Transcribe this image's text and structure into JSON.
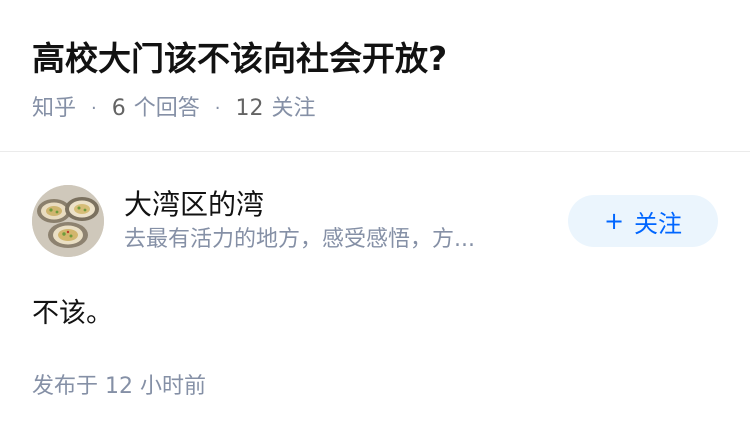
{
  "question": {
    "title": "高校大门该不该向社会开放?",
    "source": "知乎",
    "separator": "·",
    "answer_count": "6",
    "answer_label": "个回答",
    "follow_count": "12",
    "follow_label": "关注"
  },
  "answer": {
    "author_name": "大湾区的湾",
    "author_bio": "去最有活力的地方，感受感悟，方...",
    "follow_button_plus": "+",
    "follow_button_label": "关注",
    "content": "不该。",
    "published": "发布于  12 小时前"
  },
  "colors": {
    "accent": "#0066ff",
    "accent_bg": "#ebf5fd",
    "muted": "#8590a6",
    "text": "#121212"
  }
}
